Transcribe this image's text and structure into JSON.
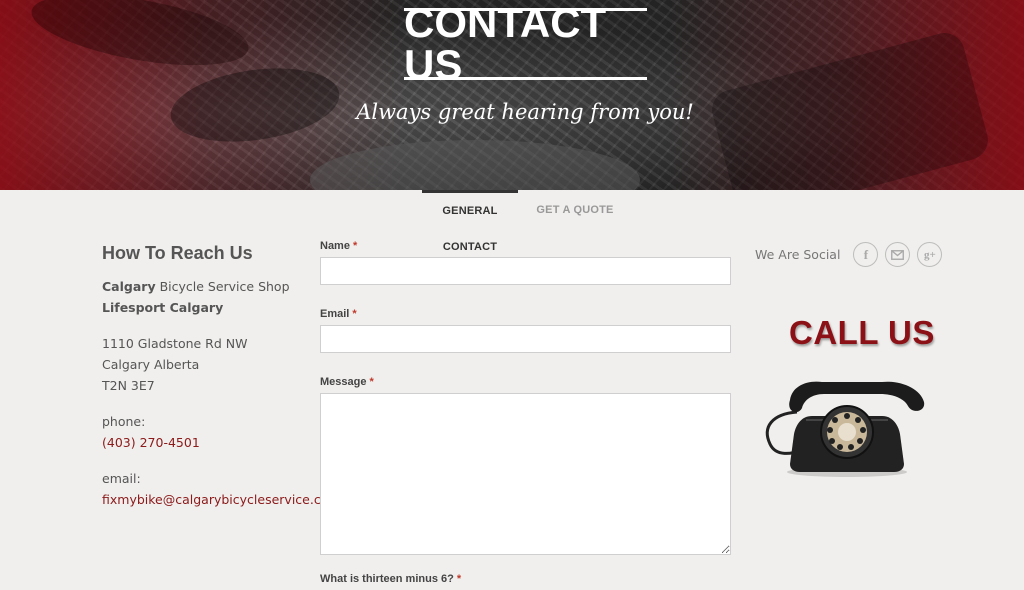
{
  "hero": {
    "title": "CONTACT US",
    "subtitle": "Always great hearing from you!"
  },
  "tabs": [
    {
      "label": "GENERAL CONTACT",
      "active": true
    },
    {
      "label": "GET A QUOTE",
      "active": false
    }
  ],
  "reach": {
    "heading": "How To Reach Us",
    "shop_bold": "Calgary",
    "shop_rest": " Bicycle Service Shop",
    "shop_line2": "Lifesport Calgary",
    "address1": "1110 Gladstone Rd NW",
    "address2": "Calgary Alberta",
    "address3": "T2N 3E7",
    "phone_label": "phone:",
    "phone": "(403) 270-4501",
    "email_label": "email:",
    "email": "fixmybike@calgarybicycleservice.com"
  },
  "form": {
    "name_label": "Name",
    "email_label": "Email",
    "message_label": "Message",
    "captcha_label": "What is thirteen minus 6?",
    "required_mark": "*",
    "name_value": "",
    "email_value": "",
    "message_value": ""
  },
  "social": {
    "label": "We Are Social",
    "icons": [
      "facebook-icon",
      "mail-icon",
      "google-plus-icon"
    ],
    "facebook_glyph": "f",
    "google_glyph": "g+"
  },
  "callout": {
    "text": "CALL US"
  },
  "colors": {
    "accent": "#8b1a1a",
    "background": "#f0efed",
    "required": "#c0392b"
  }
}
